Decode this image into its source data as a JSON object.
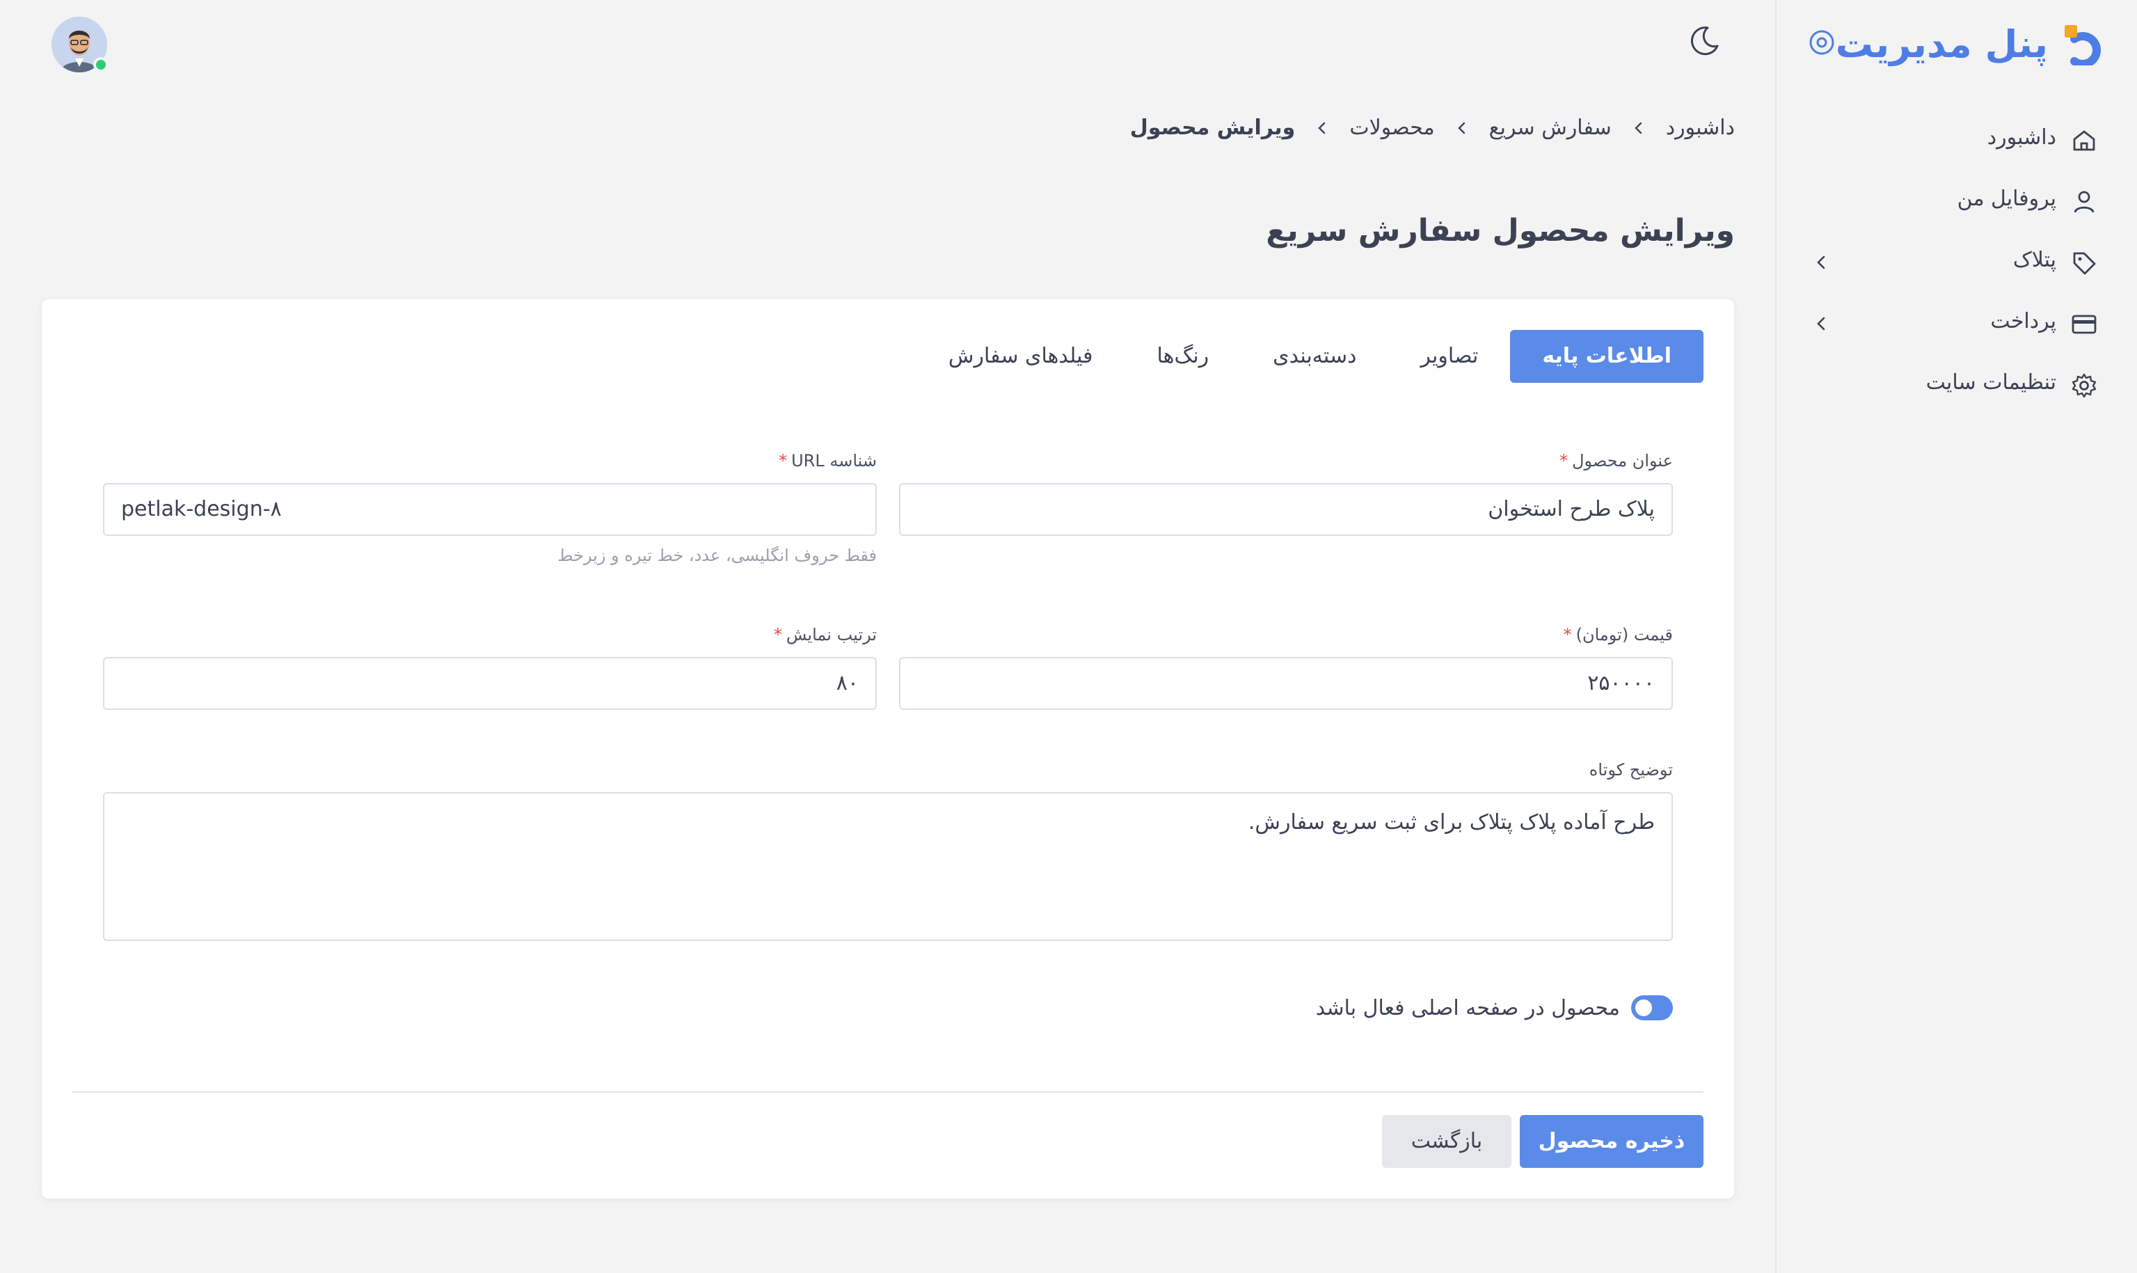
{
  "brand": {
    "title": "پنل مدیریت",
    "logo_icon": "brand-logo-icon",
    "pin_icon": "pin-icon"
  },
  "sidebar": {
    "items": [
      {
        "label": "داشبورد",
        "icon": "home-icon",
        "has_submenu": false
      },
      {
        "label": "پروفایل من",
        "icon": "user-icon",
        "has_submenu": false
      },
      {
        "label": "پتلاک",
        "icon": "tag-icon",
        "has_submenu": true
      },
      {
        "label": "پرداخت",
        "icon": "credit-card-icon",
        "has_submenu": true
      },
      {
        "label": "تنظیمات سایت",
        "icon": "gear-icon",
        "has_submenu": false
      }
    ]
  },
  "topbar": {
    "theme_icon": "moon-icon",
    "avatar_status_color": "#2ecc71"
  },
  "breadcrumb": [
    "داشبورد",
    "سفارش سریع",
    "محصولات",
    "ویرایش محصول"
  ],
  "page": {
    "title": "ویرایش محصول سفارش سریع"
  },
  "tabs": [
    {
      "label": "اطلاعات پایه",
      "active": true
    },
    {
      "label": "تصاویر",
      "active": false
    },
    {
      "label": "دسته‌بندی",
      "active": false
    },
    {
      "label": "رنگ‌ها",
      "active": false
    },
    {
      "label": "فیلدهای سفارش",
      "active": false
    }
  ],
  "form": {
    "product_title": {
      "label": "عنوان محصول",
      "required_mark": "*",
      "value": "پلاک طرح استخوان"
    },
    "url_slug": {
      "label": "شناسه URL",
      "required_mark": "*",
      "value": "petlak-design-۸",
      "hint": "فقط حروف انگلیسی، عدد، خط تیره و زیرخط"
    },
    "price": {
      "label": "قیمت (تومان)",
      "required_mark": "*",
      "value": "۲۵۰۰۰۰"
    },
    "sort_order": {
      "label": "ترتیب نمایش",
      "required_mark": "*",
      "value": "۸۰"
    },
    "short_description": {
      "label": "توضیح کوتاه",
      "value": "طرح آماده پلاک پتلاک برای ثبت سریع سفارش."
    },
    "homepage_active": {
      "label": "محصول در صفحه اصلی فعال باشد",
      "checked": true
    }
  },
  "actions": {
    "save_label": "ذخیره محصول",
    "back_label": "بازگشت"
  },
  "colors": {
    "accent": "#5b8be9",
    "brand": "#4e7ee4",
    "required": "#e5484d"
  }
}
